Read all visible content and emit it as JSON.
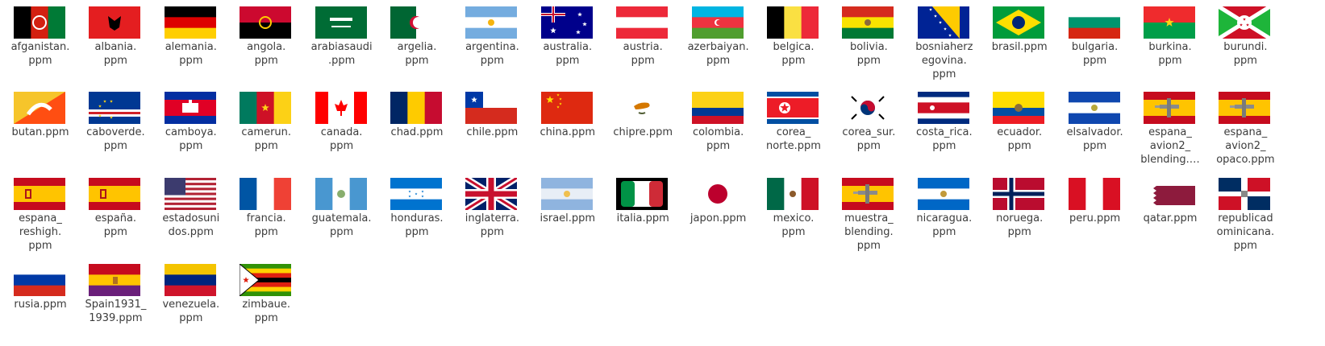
{
  "files": [
    {
      "label": "afganistan.\nppm",
      "icon": "flag-afghanistan"
    },
    {
      "label": "albania.\nppm",
      "icon": "flag-albania"
    },
    {
      "label": "alemania.\nppm",
      "icon": "flag-germany"
    },
    {
      "label": "angola.\nppm",
      "icon": "flag-angola"
    },
    {
      "label": "arabiasaudi\n.ppm",
      "icon": "flag-saudi-arabia"
    },
    {
      "label": "argelia.\nppm",
      "icon": "flag-algeria"
    },
    {
      "label": "argentina.\nppm",
      "icon": "flag-argentina"
    },
    {
      "label": "australia.\nppm",
      "icon": "flag-australia"
    },
    {
      "label": "austria.\nppm",
      "icon": "flag-austria"
    },
    {
      "label": "azerbaiyan.\nppm",
      "icon": "flag-azerbaijan"
    },
    {
      "label": "belgica.\nppm",
      "icon": "flag-belgium"
    },
    {
      "label": "bolivia.\nppm",
      "icon": "flag-bolivia"
    },
    {
      "label": "bosniaherz\negovina.\nppm",
      "icon": "flag-bosnia"
    },
    {
      "label": "brasil.ppm",
      "icon": "flag-brazil"
    },
    {
      "label": "bulgaria.\nppm",
      "icon": "flag-bulgaria"
    },
    {
      "label": "burkina.\nppm",
      "icon": "flag-burkina-faso"
    },
    {
      "label": "burundi.\nppm",
      "icon": "flag-burundi"
    },
    {
      "label": "butan.ppm",
      "icon": "flag-bhutan"
    },
    {
      "label": "caboverde.\nppm",
      "icon": "flag-cape-verde"
    },
    {
      "label": "camboya.\nppm",
      "icon": "flag-cambodia"
    },
    {
      "label": "camerun.\nppm",
      "icon": "flag-cameroon"
    },
    {
      "label": "canada.\nppm",
      "icon": "flag-canada"
    },
    {
      "label": "chad.ppm",
      "icon": "flag-chad"
    },
    {
      "label": "chile.ppm",
      "icon": "flag-chile"
    },
    {
      "label": "china.ppm",
      "icon": "flag-china"
    },
    {
      "label": "chipre.ppm",
      "icon": "flag-cyprus"
    },
    {
      "label": "colombia.\nppm",
      "icon": "flag-colombia"
    },
    {
      "label": "corea_\nnorte.ppm",
      "icon": "flag-north-korea"
    },
    {
      "label": "corea_sur.\nppm",
      "icon": "flag-south-korea"
    },
    {
      "label": "costa_rica.\nppm",
      "icon": "flag-costa-rica"
    },
    {
      "label": "ecuador.\nppm",
      "icon": "flag-ecuador"
    },
    {
      "label": "elsalvador.\nppm",
      "icon": "flag-el-salvador"
    },
    {
      "label": "espana_\navion2_\nblending.…",
      "icon": "flag-spain-airplane"
    },
    {
      "label": "espana_\navion2_\nopaco.ppm",
      "icon": "flag-spain-airplane"
    },
    {
      "label": "espana_\nreshigh.\nppm",
      "icon": "flag-spain"
    },
    {
      "label": "españa.\nppm",
      "icon": "flag-spain"
    },
    {
      "label": "estadosuni\ndos.ppm",
      "icon": "flag-usa"
    },
    {
      "label": "francia.\nppm",
      "icon": "flag-france"
    },
    {
      "label": "guatemala.\nppm",
      "icon": "flag-guatemala"
    },
    {
      "label": "honduras.\nppm",
      "icon": "flag-honduras"
    },
    {
      "label": "inglaterra.\nppm",
      "icon": "flag-uk"
    },
    {
      "label": "israel.ppm",
      "icon": "flag-israel"
    },
    {
      "label": "italia.ppm",
      "icon": "flag-italy"
    },
    {
      "label": "japon.ppm",
      "icon": "flag-japan"
    },
    {
      "label": "mexico.\nppm",
      "icon": "flag-mexico"
    },
    {
      "label": "muestra_\nblending.\nppm",
      "icon": "flag-spain-airplane"
    },
    {
      "label": "nicaragua.\nppm",
      "icon": "flag-nicaragua"
    },
    {
      "label": "noruega.\nppm",
      "icon": "flag-norway"
    },
    {
      "label": "peru.ppm",
      "icon": "flag-peru"
    },
    {
      "label": "qatar.ppm",
      "icon": "flag-qatar"
    },
    {
      "label": "republicad\nominicana.\nppm",
      "icon": "flag-dominican-republic"
    },
    {
      "label": "rusia.ppm",
      "icon": "flag-russia"
    },
    {
      "label": "Spain1931_\n1939.ppm",
      "icon": "flag-spain-1931"
    },
    {
      "label": "venezuela.\nppm",
      "icon": "flag-venezuela"
    },
    {
      "label": "zimbaue.\nppm",
      "icon": "flag-zimbabwe"
    }
  ]
}
